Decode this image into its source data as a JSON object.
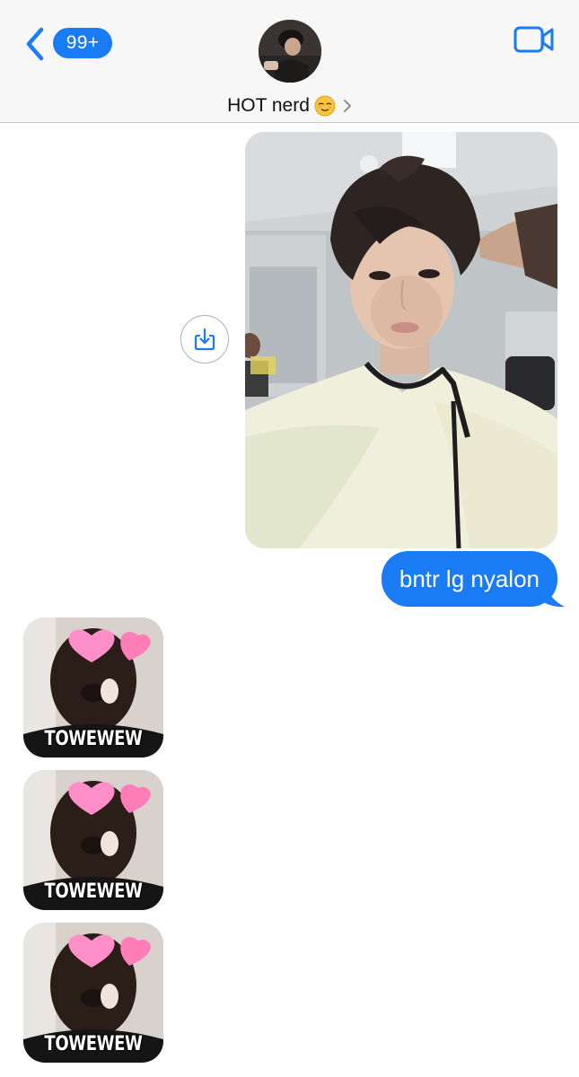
{
  "header": {
    "unread_count": "99+",
    "contact_name": "HOT nerd",
    "contact_emoji": "relieved-face",
    "accent_color": "#1a7cf5"
  },
  "thread": {
    "photo": {
      "description_icon": "selfie-photo",
      "action_icon": "save-download-icon"
    },
    "sent_message": "bntr lg nyalon",
    "stickers": [
      {
        "caption": "TOWEWEW"
      },
      {
        "caption": "TOWEWEW"
      },
      {
        "caption": "TOWEWEW"
      }
    ]
  }
}
